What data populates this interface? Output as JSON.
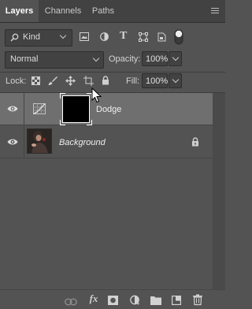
{
  "tabs": [
    {
      "label": "Layers",
      "active": true
    },
    {
      "label": "Channels",
      "active": false
    },
    {
      "label": "Paths",
      "active": false
    }
  ],
  "filter": {
    "kind_label": "Kind",
    "icons": [
      "pixel-layer-filter-icon",
      "adjustment-layer-filter-icon",
      "type-layer-filter-icon",
      "shape-layer-filter-icon",
      "smart-object-filter-icon",
      "filter-toggle-icon"
    ]
  },
  "blend": {
    "mode": "Normal",
    "opacity_label": "Opacity:",
    "opacity_value": "100%"
  },
  "lock": {
    "label": "Lock:",
    "icons": [
      "lock-transparent-pixels-icon",
      "lock-image-pixels-icon",
      "lock-position-icon",
      "lock-artboard-icon",
      "lock-all-icon"
    ],
    "fill_label": "Fill:",
    "fill_value": "100%"
  },
  "layers": [
    {
      "name": "Dodge",
      "type": "adjustment",
      "visible": true,
      "selected": true,
      "locked": false
    },
    {
      "name": "Background",
      "type": "image",
      "visible": true,
      "selected": false,
      "locked": true
    }
  ],
  "bottom_icons": [
    "link-layers-icon",
    "fx-icon",
    "layer-mask-icon",
    "adjustment-layer-icon",
    "group-folder-icon",
    "new-layer-icon",
    "trash-icon"
  ],
  "colors": {
    "panel_bg": "#535353",
    "selected_row": "#6f6f6f",
    "tab_bar": "#424242"
  }
}
